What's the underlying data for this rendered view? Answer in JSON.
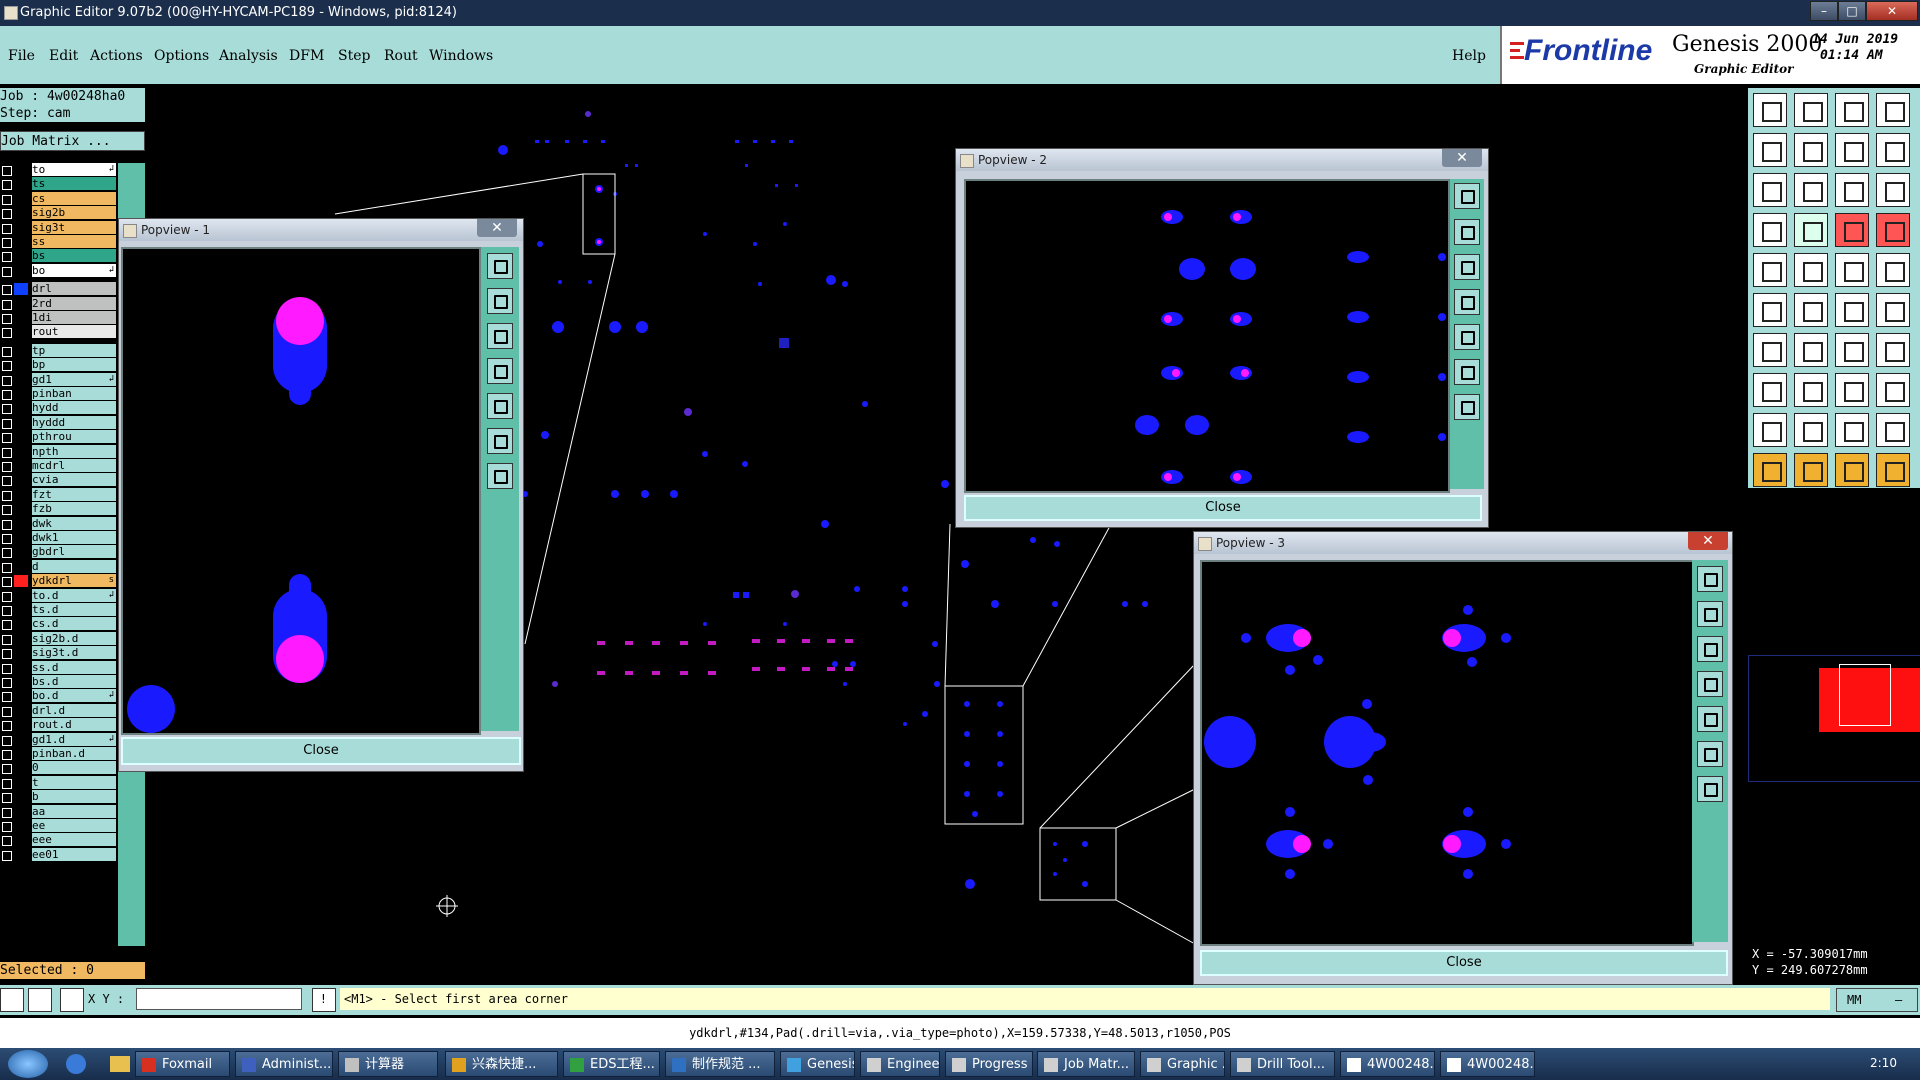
{
  "window": {
    "title": "Graphic Editor 9.07b2 (00@HY-HYCAM-PC189 - Windows, pid:8124)"
  },
  "menu": [
    "File",
    "Edit",
    "Actions",
    "Options",
    "Analysis",
    "DFM",
    "Step",
    "Rout",
    "Windows"
  ],
  "help_label": "Help",
  "brand": {
    "logo": "Frontline",
    "product": "Genesis 2000",
    "subtitle": "Graphic Editor",
    "date": "14 Jun 2019",
    "time": "01:14 AM"
  },
  "job": {
    "job_label": "Job  :  4w00248ha0",
    "step_label": "Step: cam",
    "matrix_button": "Job Matrix ..."
  },
  "layers": [
    {
      "name": "to",
      "color": "#ffffff",
      "mark": "↲"
    },
    {
      "name": "ts",
      "color": "#2fa68a"
    },
    {
      "name": "cs",
      "color": "#f0b860"
    },
    {
      "name": "sig2b",
      "color": "#f0b860"
    },
    {
      "name": "sig3t",
      "color": "#f0b860"
    },
    {
      "name": "ss",
      "color": "#f0b860"
    },
    {
      "name": "bs",
      "color": "#2fa68a"
    },
    {
      "name": "bo",
      "color": "#ffffff",
      "mark": "↲"
    },
    {
      "name": "drl",
      "color": "#bfc0c0",
      "swatch": "#1040ff"
    },
    {
      "name": "2rd",
      "color": "#bfc0c0"
    },
    {
      "name": "1di",
      "color": "#bfc0c0"
    },
    {
      "name": "rout",
      "color": "#e8e8e8"
    },
    {
      "name": "tp",
      "color": "#a8dcd8"
    },
    {
      "name": "bp",
      "color": "#a8dcd8"
    },
    {
      "name": "gd1",
      "color": "#a8dcd8",
      "mark": "↲"
    },
    {
      "name": "pinban",
      "color": "#a8dcd8"
    },
    {
      "name": "hydd",
      "color": "#a8dcd8"
    },
    {
      "name": "hyddd",
      "color": "#a8dcd8"
    },
    {
      "name": "pthrou",
      "color": "#a8dcd8"
    },
    {
      "name": "npth",
      "color": "#a8dcd8"
    },
    {
      "name": "mcdrl",
      "color": "#a8dcd8"
    },
    {
      "name": "cvia",
      "color": "#a8dcd8"
    },
    {
      "name": "fzt",
      "color": "#a8dcd8"
    },
    {
      "name": "fzb",
      "color": "#a8dcd8"
    },
    {
      "name": "dwk",
      "color": "#a8dcd8"
    },
    {
      "name": "dwk1",
      "color": "#a8dcd8"
    },
    {
      "name": "gbdrl",
      "color": "#a8dcd8"
    },
    {
      "name": "d",
      "color": "#a8dcd8"
    },
    {
      "name": "ydkdrl",
      "color": "#f0b860",
      "swatch": "#ff2020",
      "mark": "s"
    },
    {
      "name": "to.d",
      "color": "#a8dcd8",
      "mark": "↲"
    },
    {
      "name": "ts.d",
      "color": "#a8dcd8"
    },
    {
      "name": "cs.d",
      "color": "#a8dcd8"
    },
    {
      "name": "sig2b.d",
      "color": "#a8dcd8"
    },
    {
      "name": "sig3t.d",
      "color": "#a8dcd8"
    },
    {
      "name": "ss.d",
      "color": "#a8dcd8"
    },
    {
      "name": "bs.d",
      "color": "#a8dcd8"
    },
    {
      "name": "bo.d",
      "color": "#a8dcd8",
      "mark": "↲"
    },
    {
      "name": "drl.d",
      "color": "#a8dcd8"
    },
    {
      "name": "rout.d",
      "color": "#a8dcd8"
    },
    {
      "name": "gd1.d",
      "color": "#a8dcd8",
      "mark": "↲"
    },
    {
      "name": "pinban.d",
      "color": "#a8dcd8"
    },
    {
      "name": "0",
      "color": "#a8dcd8"
    },
    {
      "name": "t",
      "color": "#a8dcd8"
    },
    {
      "name": "b",
      "color": "#a8dcd8"
    },
    {
      "name": "aa",
      "color": "#a8dcd8"
    },
    {
      "name": "ee",
      "color": "#a8dcd8"
    },
    {
      "name": "eee",
      "color": "#a8dcd8"
    },
    {
      "name": "ee01",
      "color": "#a8dcd8"
    }
  ],
  "selected_label": "Selected : 0",
  "popviews": [
    {
      "title": "Popview - 1",
      "close": "Close"
    },
    {
      "title": "Popview - 2",
      "close": "Close"
    },
    {
      "title": "Popview - 3",
      "close": "Close"
    }
  ],
  "coords": {
    "x": "X =  -57.309017mm",
    "y": "Y =  249.607278mm"
  },
  "command": {
    "xy_label": "X Y :",
    "prompt": "<M1> - Select first area corner",
    "unit": "MM"
  },
  "status_line": "ydkdrl,#134,Pad(.drill=via,.via_type=photo),X=159.57338,Y=48.5013,r1050,POS",
  "taskbar": {
    "items": [
      "Foxmail",
      "Administ...",
      "计算器",
      "兴森快捷...",
      "EDS工程...",
      "制作规范 ...",
      "Genesis",
      "Engineeri...",
      "Progress",
      "Job Matr...",
      "Graphic ...",
      "Drill Tool...",
      "4W00248...",
      "4W00248..."
    ],
    "clock": "2:10"
  },
  "colors": {
    "panel": "#a8dcd8",
    "drill_blue": "#1a1aff",
    "pad_magenta": "#ff1aff",
    "accent_teal": "#60bfa8"
  }
}
